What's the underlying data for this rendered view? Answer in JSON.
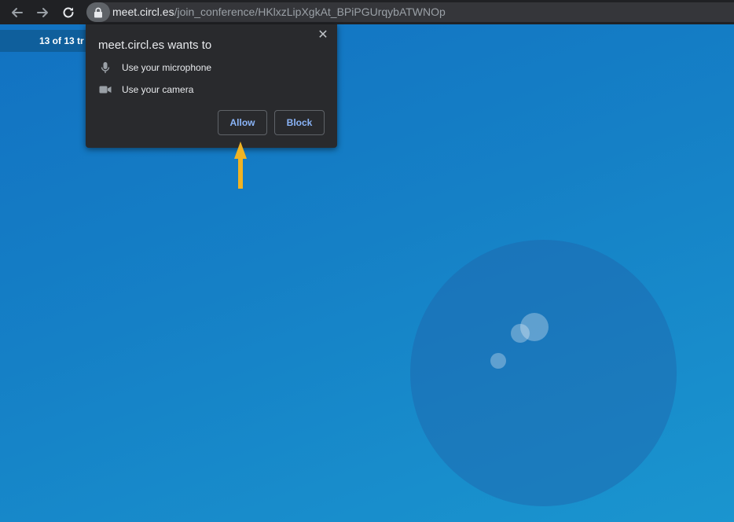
{
  "browser": {
    "url_host": "meet.circl.es",
    "url_path": "/join_conference/HKlxzLipXgkAt_BPiPGUrqybATWNOp"
  },
  "page": {
    "tab_strip_label": "13 of 13 tr"
  },
  "permission_popup": {
    "title": "meet.circl.es wants to",
    "close_label": "✕",
    "permissions": [
      {
        "icon": "microphone-icon",
        "label": "Use your microphone"
      },
      {
        "icon": "camera-icon",
        "label": "Use your camera"
      }
    ],
    "allow_label": "Allow",
    "block_label": "Block"
  },
  "colors": {
    "accent_button_text": "#8ab4f8",
    "arrow": "#f0b323",
    "background_blue": "#1580c6"
  }
}
